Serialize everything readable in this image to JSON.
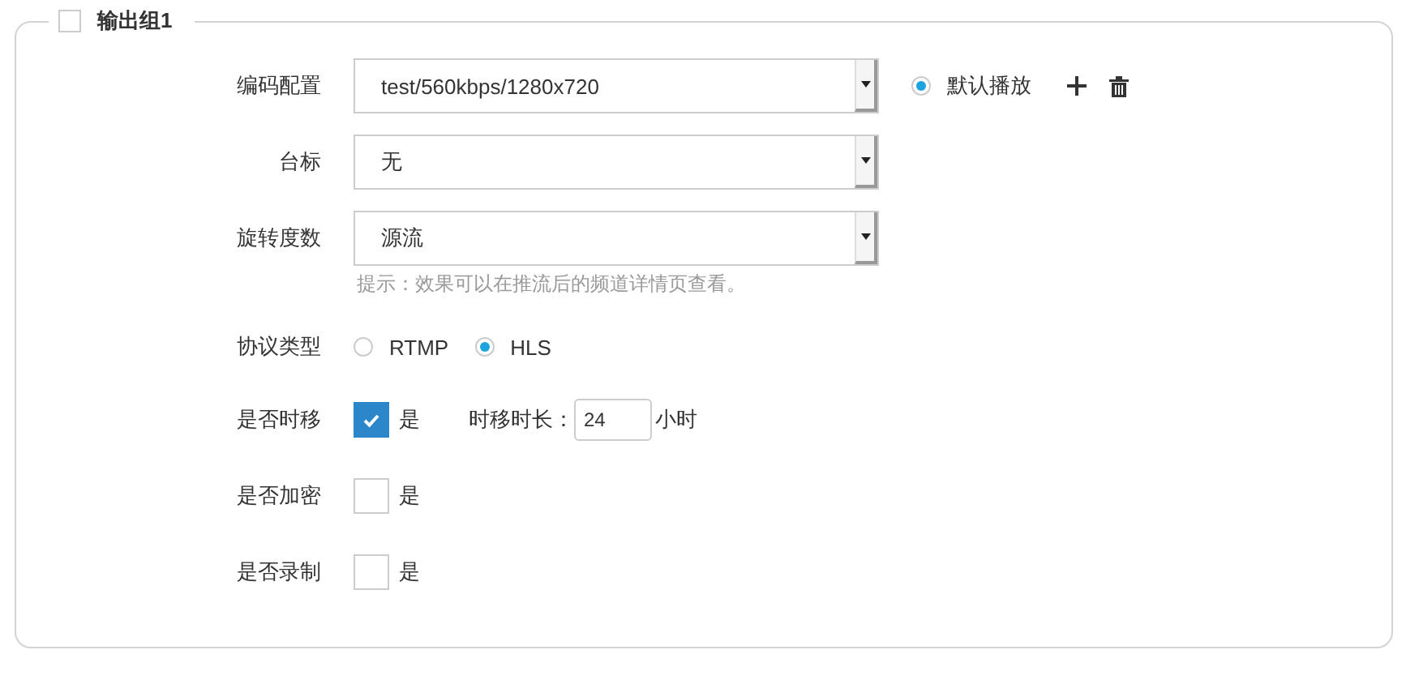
{
  "group": {
    "title": "输出组1",
    "checked": false
  },
  "selects": [
    {
      "label": "编码配置",
      "value": "test/560kbps/1280x720"
    },
    {
      "label": "台标",
      "value": "无"
    },
    {
      "label": "旋转度数",
      "value": "源流"
    }
  ],
  "default_play": {
    "label": "默认播放",
    "selected": true
  },
  "hint": "提示：效果可以在推流后的频道详情页查看。",
  "protocol": {
    "label": "协议类型",
    "options": [
      {
        "label": "RTMP",
        "selected": false
      },
      {
        "label": "HLS",
        "selected": true
      }
    ]
  },
  "checks": [
    {
      "label": "是否时移",
      "option": "是",
      "checked": true,
      "duration": {
        "label": "时移时长：",
        "value": "24",
        "unit": "小时"
      }
    },
    {
      "label": "是否加密",
      "option": "是",
      "checked": false
    },
    {
      "label": "是否录制",
      "option": "是",
      "checked": false
    }
  ]
}
